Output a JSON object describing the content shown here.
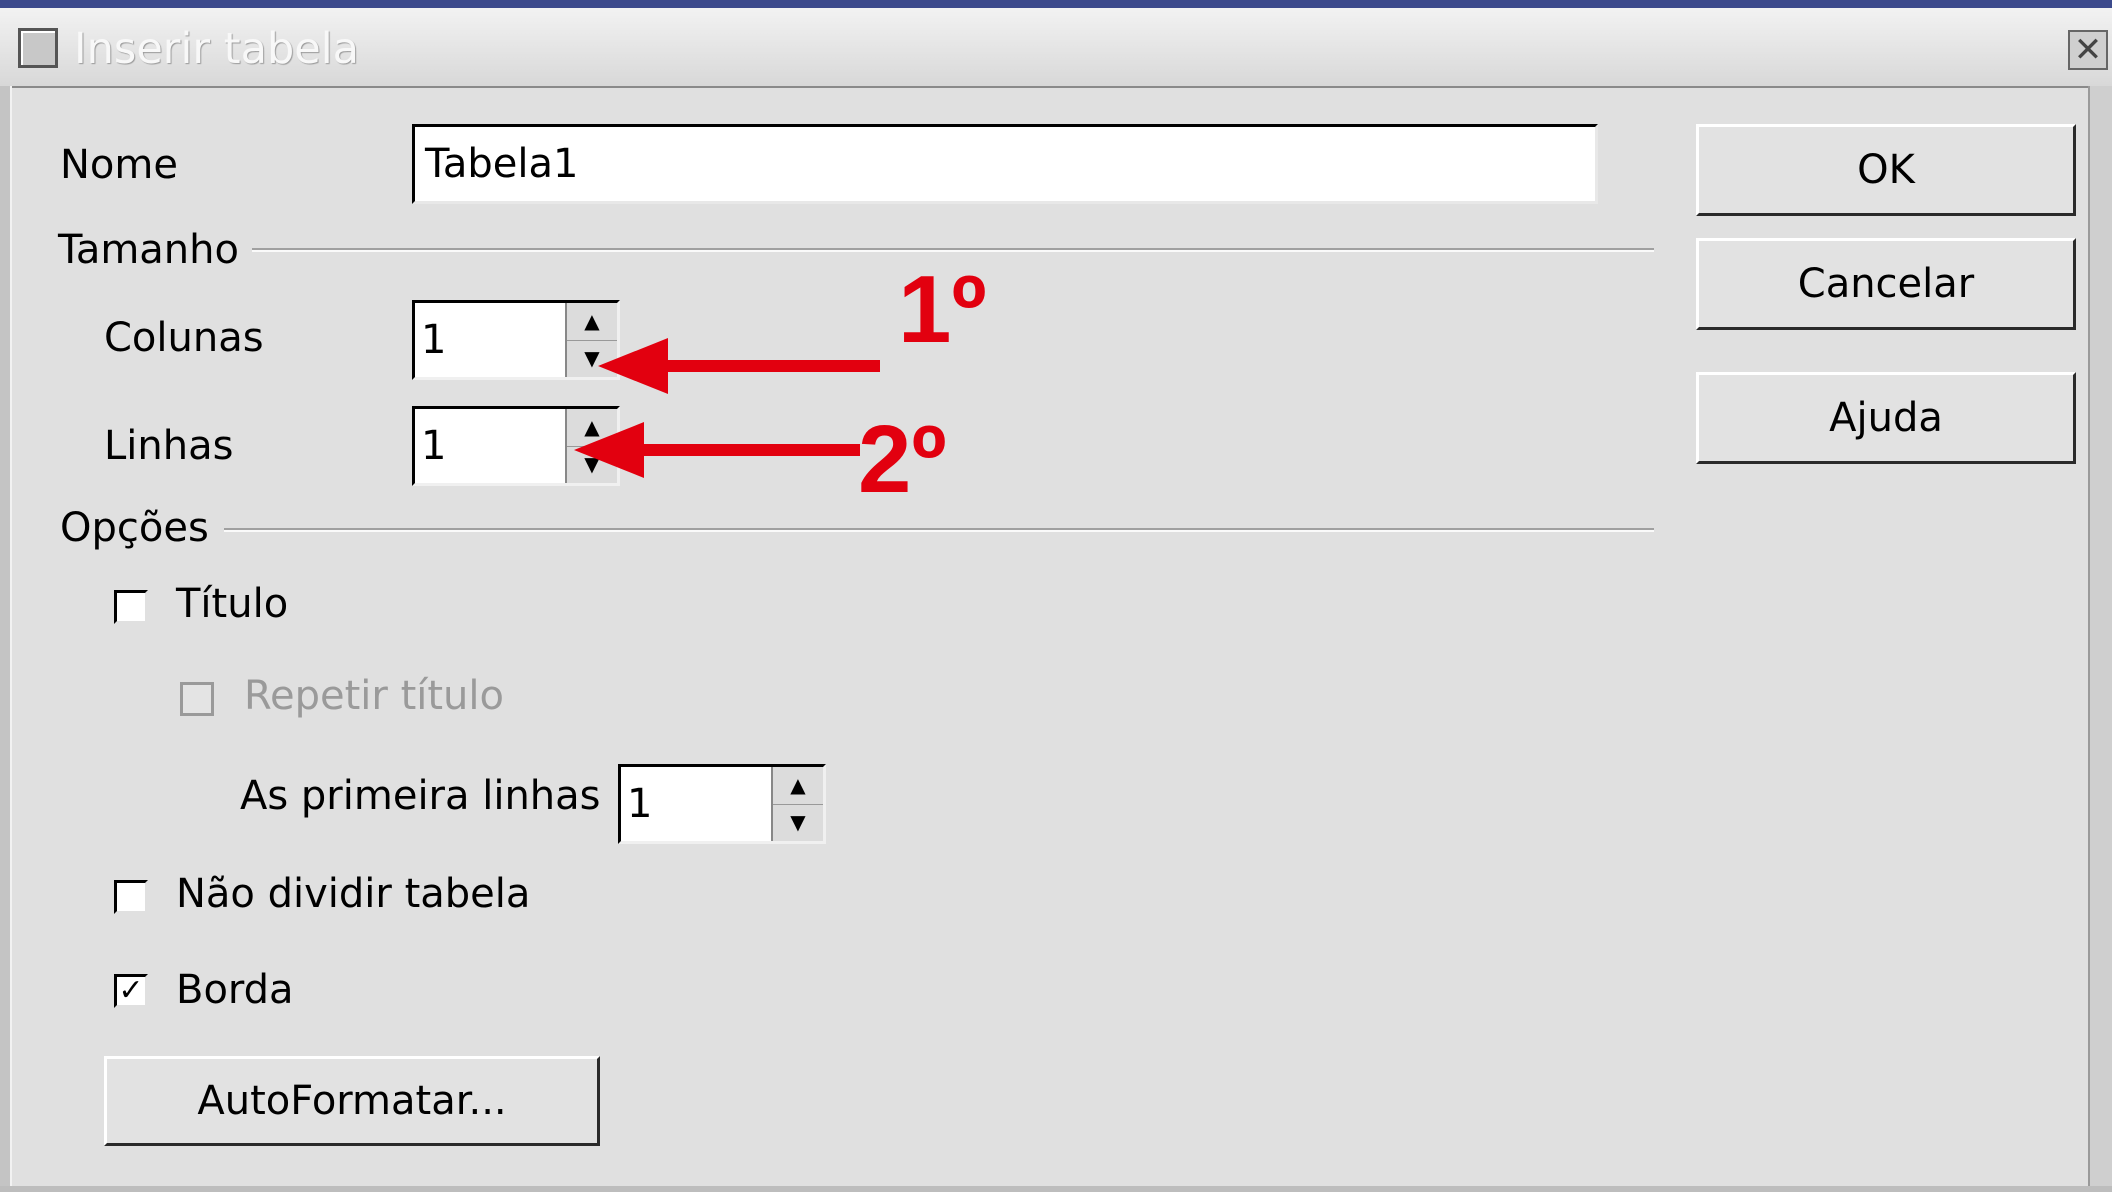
{
  "window": {
    "title": "Inserir tabela",
    "close_glyph": "✕"
  },
  "name_field": {
    "label": "Nome",
    "value": "Tabela1"
  },
  "size_group": {
    "legend": "Tamanho",
    "columns": {
      "label": "Colunas",
      "value": "1"
    },
    "rows": {
      "label": "Linhas",
      "value": "1"
    }
  },
  "options_group": {
    "legend": "Opções",
    "title": {
      "label": "Título",
      "checked": false
    },
    "repeat_title": {
      "label": "Repetir título",
      "checked": false,
      "enabled": false
    },
    "first_rows": {
      "label": "As primeira linhas",
      "value": "1"
    },
    "no_split": {
      "label": "Não dividir tabela",
      "checked": false
    },
    "border": {
      "label": "Borda",
      "checked": true,
      "check_glyph": "✓"
    }
  },
  "buttons": {
    "ok": "OK",
    "cancel": "Cancelar",
    "help": "Ajuda",
    "autoformat": "AutoFormatar..."
  },
  "annotations": {
    "first": "1º",
    "second": "2º",
    "arrow_color": "#e2000f"
  },
  "spin_glyphs": {
    "up": "▲",
    "down": "▼"
  }
}
